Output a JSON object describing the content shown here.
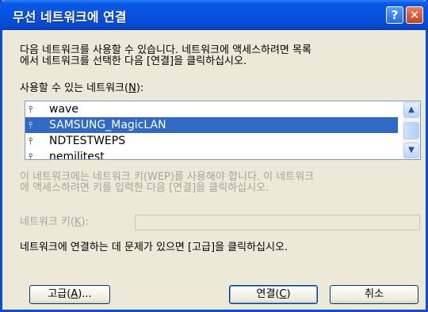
{
  "window": {
    "title": "무선 네트워크에 연결",
    "help_glyph": "?",
    "close_glyph": "✕"
  },
  "instructions": {
    "line1": "다음 네트워크를 사용할 수 있습니다. 네트워크에 액세스하려면 목록",
    "line2": "에서 네트워크를 선택한 다음 [연결]을 클릭하십시오."
  },
  "available_label": {
    "before": "사용할 수 있는 네트워크(",
    "key": "N",
    "after": "):"
  },
  "networks": [
    {
      "name": "wave",
      "selected": false
    },
    {
      "name": "SAMSUNG_MagicLAN",
      "selected": true
    },
    {
      "name": "NDTESTWEPS",
      "selected": false
    },
    {
      "name": "nemilitest",
      "selected": false
    }
  ],
  "wep_note": {
    "line1": "이 네트워크에는 네트워크 키(WEP)를 사용해야 합니다. 이 네트워크",
    "line2": "에 액세스하려면 키를 입력한 다음 [연결]을 클릭하십시오."
  },
  "network_key": {
    "before": "네트워크 키(",
    "key": "K",
    "after": "):",
    "value": ""
  },
  "help_text": "네트워크에 연결하는 데 문제가 있으면 [고급]을 클릭하십시오.",
  "buttons": {
    "advanced": {
      "before": "고급(",
      "key": "A",
      "after": ")..."
    },
    "connect": {
      "before": "연결(",
      "key": "C",
      "after": ")"
    },
    "cancel": "취소"
  },
  "icons": {
    "network": "wireless-network-icon",
    "scroll_up": "arrow-up-icon",
    "scroll_down": "arrow-down-icon"
  }
}
